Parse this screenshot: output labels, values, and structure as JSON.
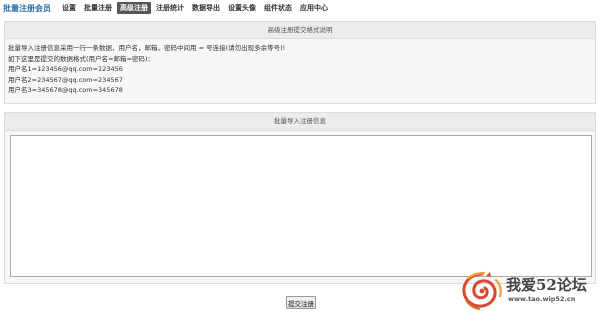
{
  "header": {
    "app_title": "批量注册会员",
    "tabs": [
      {
        "label": "设置",
        "active": false
      },
      {
        "label": "批量注册",
        "active": false
      },
      {
        "label": "高级注册",
        "active": true
      },
      {
        "label": "注册统计",
        "active": false
      },
      {
        "label": "数据导出",
        "active": false
      },
      {
        "label": "设置头像",
        "active": false
      },
      {
        "label": "组件状态",
        "active": false
      },
      {
        "label": "应用中心",
        "active": false
      }
    ]
  },
  "info_panel": {
    "title": "高级注册提交格式说明",
    "lines": [
      "批量导入注册信息采用一行一条数据，用户名，邮箱，密码中间用 = 号连接(请勿出现多余等号)!",
      "如下这里是提交的数据格式(用户名=邮箱=密码)：",
      "用户名1=123456@qq.com=123456",
      "用户名2=234567@qq.com=234567",
      "用户名3=345678@qq.com=345678"
    ]
  },
  "import_panel": {
    "title": "批量导入注册信息",
    "textarea_value": ""
  },
  "submit": {
    "label": "提交注册"
  },
  "watermark": {
    "title": "我爱52论坛",
    "url": "www.tao.wip52.cn"
  },
  "colors": {
    "title_blue": "#2b6fb0",
    "active_tab_bg": "#555555",
    "panel_bg": "#f7f7f7",
    "panel_header_bg": "#ececec",
    "logo_red": "#d8482f",
    "logo_orange": "#f2a03a"
  }
}
